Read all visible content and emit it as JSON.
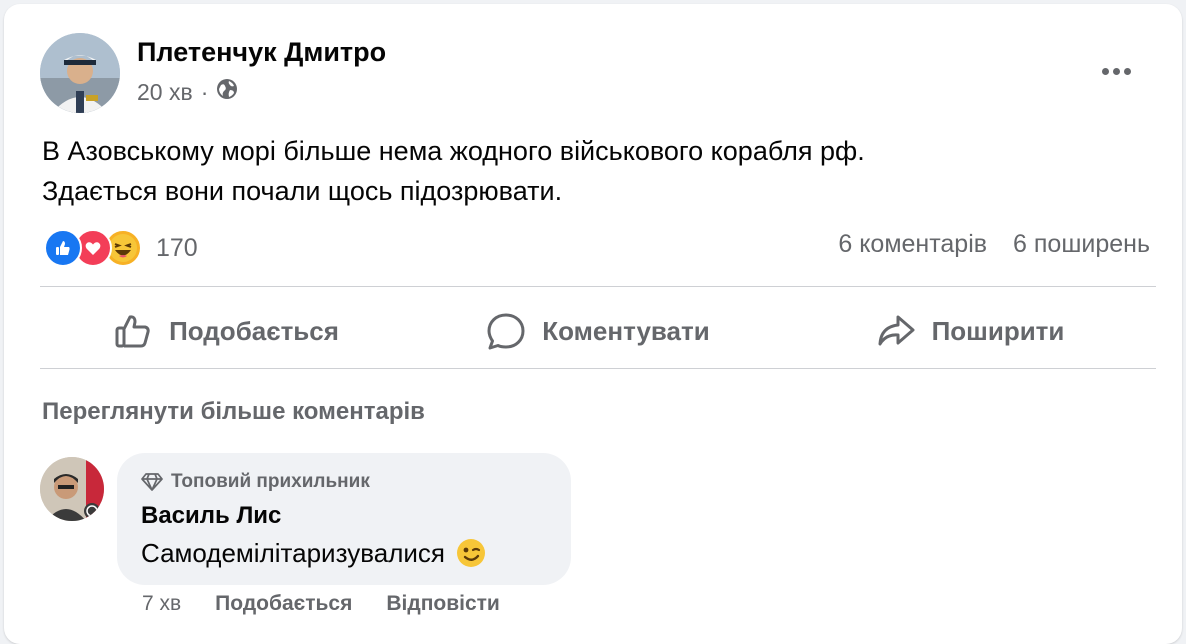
{
  "post": {
    "author": "Плетенчук Дмитро",
    "time": "20 хв",
    "separator": "·",
    "privacy_icon": "globe-icon",
    "text_line1": "В Азовському морі більше нема жодного військового корабля рф.",
    "text_line2": "Здається вони почали щось підозрювати.",
    "reactions": [
      "like",
      "love",
      "haha"
    ],
    "reaction_count": "170",
    "comments_count": "6 коментарів",
    "shares_count": "6 поширень"
  },
  "actions": {
    "like": "Подобається",
    "comment": "Коментувати",
    "share": "Поширити"
  },
  "see_more_comments": "Переглянути більше коментарів",
  "comment": {
    "badge": "Топовий прихильник",
    "author": "Василь Лис",
    "text": "Самодемілітаризувалися",
    "emoji_icon": "winking-face-icon",
    "time": "7 хв",
    "like": "Подобається",
    "reply": "Відповісти"
  },
  "colors": {
    "secondary_text": "#65676b",
    "like_blue": "#1877f2",
    "love_red": "#f33e58",
    "haha_yellow": "#f7b125",
    "bubble_bg": "#f0f2f5"
  }
}
